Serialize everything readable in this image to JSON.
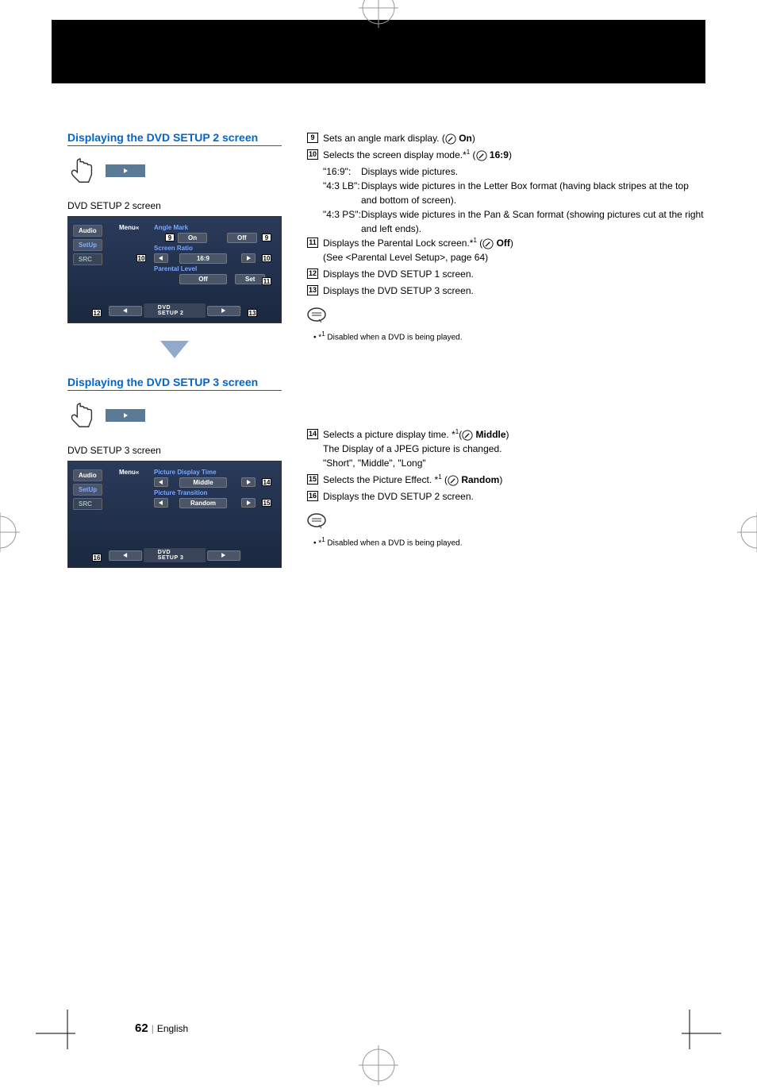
{
  "section2": {
    "heading": "Displaying the DVD SETUP 2 screen",
    "screen_caption": "DVD SETUP 2 screen",
    "menu_label": "Menu«",
    "buttons": {
      "audio": "Audio",
      "setup": "SetUp",
      "src": "SRC"
    },
    "labels": {
      "angle_mark": "Angle Mark",
      "screen_ratio": "Screen Ratio",
      "parental_level": "Parental Level"
    },
    "values": {
      "on": "On",
      "off": "Off",
      "ratio": "16:9",
      "off2": "Off",
      "set": "Set"
    },
    "bottom_title": "DVD SETUP 2"
  },
  "section3": {
    "heading": "Displaying the DVD SETUP 3 screen",
    "screen_caption": "DVD SETUP 3 screen",
    "menu_label": "Menu«",
    "buttons": {
      "audio": "Audio",
      "setup": "SetUp",
      "src": "SRC"
    },
    "labels": {
      "picture_display_time": "Picture Display Time",
      "picture_transition": "Picture Transition"
    },
    "values": {
      "middle": "Middle",
      "random": "Random"
    },
    "bottom_title": "DVD SETUP 3"
  },
  "descriptions2": {
    "i9": "Sets an angle mark display. (",
    "i9_default": "On",
    "i9_end": ")",
    "i10": "Selects the screen display mode.*",
    "i10_sup": "1",
    "i10_paren": " (",
    "i10_default": "16:9",
    "i10_end": ")",
    "i10_169_label": "\"16:9\":",
    "i10_169_text": "Displays wide pictures.",
    "i10_43lb_label": "\"4:3 LB\":",
    "i10_43lb_text": "Displays wide pictures in the Letter Box format (having black stripes at the top and bottom of screen).",
    "i10_43ps_label": "\"4:3 PS\":",
    "i10_43ps_text": "Displays wide pictures in the Pan & Scan format (showing pictures cut at the right and left ends).",
    "i11": "Displays the Parental Lock screen.*",
    "i11_sup": "1",
    "i11_paren": " (",
    "i11_default": "Off",
    "i11_end": ")",
    "i11_see": "(See <Parental Level Setup>, page 64)",
    "i12": "Displays the DVD SETUP 1 screen.",
    "i13": "Displays the DVD SETUP 3 screen.",
    "note": "Disabled when a DVD is being played.",
    "note_prefix": "*",
    "note_sup": "1"
  },
  "descriptions3": {
    "i14": "Selects a picture display time. *",
    "i14_sup": "1",
    "i14_paren": "(",
    "i14_default": "Middle",
    "i14_end": ")",
    "i14_sub1": "The Display of a JPEG picture is changed.",
    "i14_sub2": "\"Short\", \"Middle\", \"Long\"",
    "i15": "Selects the Picture Effect. *",
    "i15_sup": "1",
    "i15_paren": " (",
    "i15_default": "Random",
    "i15_end": ")",
    "i16": "Displays the DVD SETUP 2 screen.",
    "note": "Disabled when a DVD is being played.",
    "note_prefix": "*",
    "note_sup": "1"
  },
  "page_number": "62",
  "page_lang": "English"
}
